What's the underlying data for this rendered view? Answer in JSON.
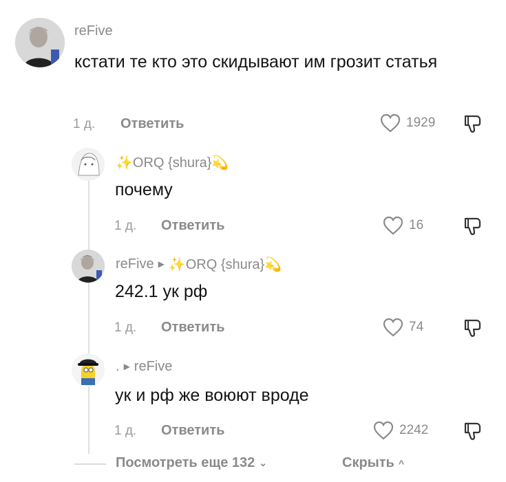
{
  "comments": [
    {
      "username": "reFive",
      "text": "кстати те кто это скидывают им грозит статья",
      "age": "1 д.",
      "reply_label": "Ответить",
      "likes": "1929"
    },
    {
      "username": "✨ORQ {shura}💫",
      "text": "почему",
      "age": "1 д.",
      "reply_label": "Ответить",
      "likes": "16"
    },
    {
      "username": "reFive",
      "reply_to": "✨ORQ {shura}💫",
      "text": "242.1 ук рф",
      "age": "1 д.",
      "reply_label": "Ответить",
      "likes": "74"
    },
    {
      "username": ".",
      "reply_to": "reFive",
      "text": "ук и рф же воюют вроде",
      "age": "1 д.",
      "reply_label": "Ответить",
      "likes": "2242"
    }
  ],
  "footer": {
    "view_more": "Посмотреть еще 132",
    "hide": "Скрыть"
  },
  "colors": {
    "text": "#141414",
    "muted": "#8a8a8a",
    "accent": "#f2b600"
  }
}
